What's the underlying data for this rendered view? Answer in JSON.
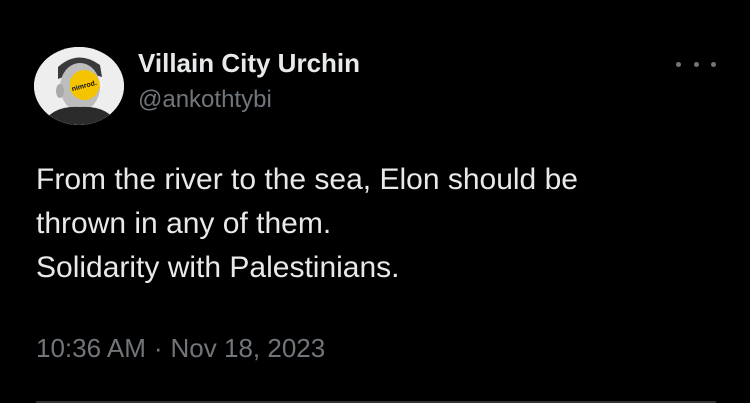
{
  "author": {
    "display_name": "Villain City Urchin",
    "handle": "@ankothtybi",
    "avatar_badge_text": "nimrod."
  },
  "tweet": {
    "lines": [
      "From the river to the sea, Elon should be",
      "thrown in any of them.",
      "Solidarity with Palestinians."
    ],
    "time": "10:36 AM",
    "separator": "·",
    "date": "Nov 18, 2023"
  },
  "icons": {
    "more": "more-horizontal-icon"
  },
  "colors": {
    "background": "#000000",
    "primary_text": "#e7e9ea",
    "secondary_text": "#71767b",
    "avatar_badge": "#f5c400",
    "divider": "#2f3336"
  }
}
